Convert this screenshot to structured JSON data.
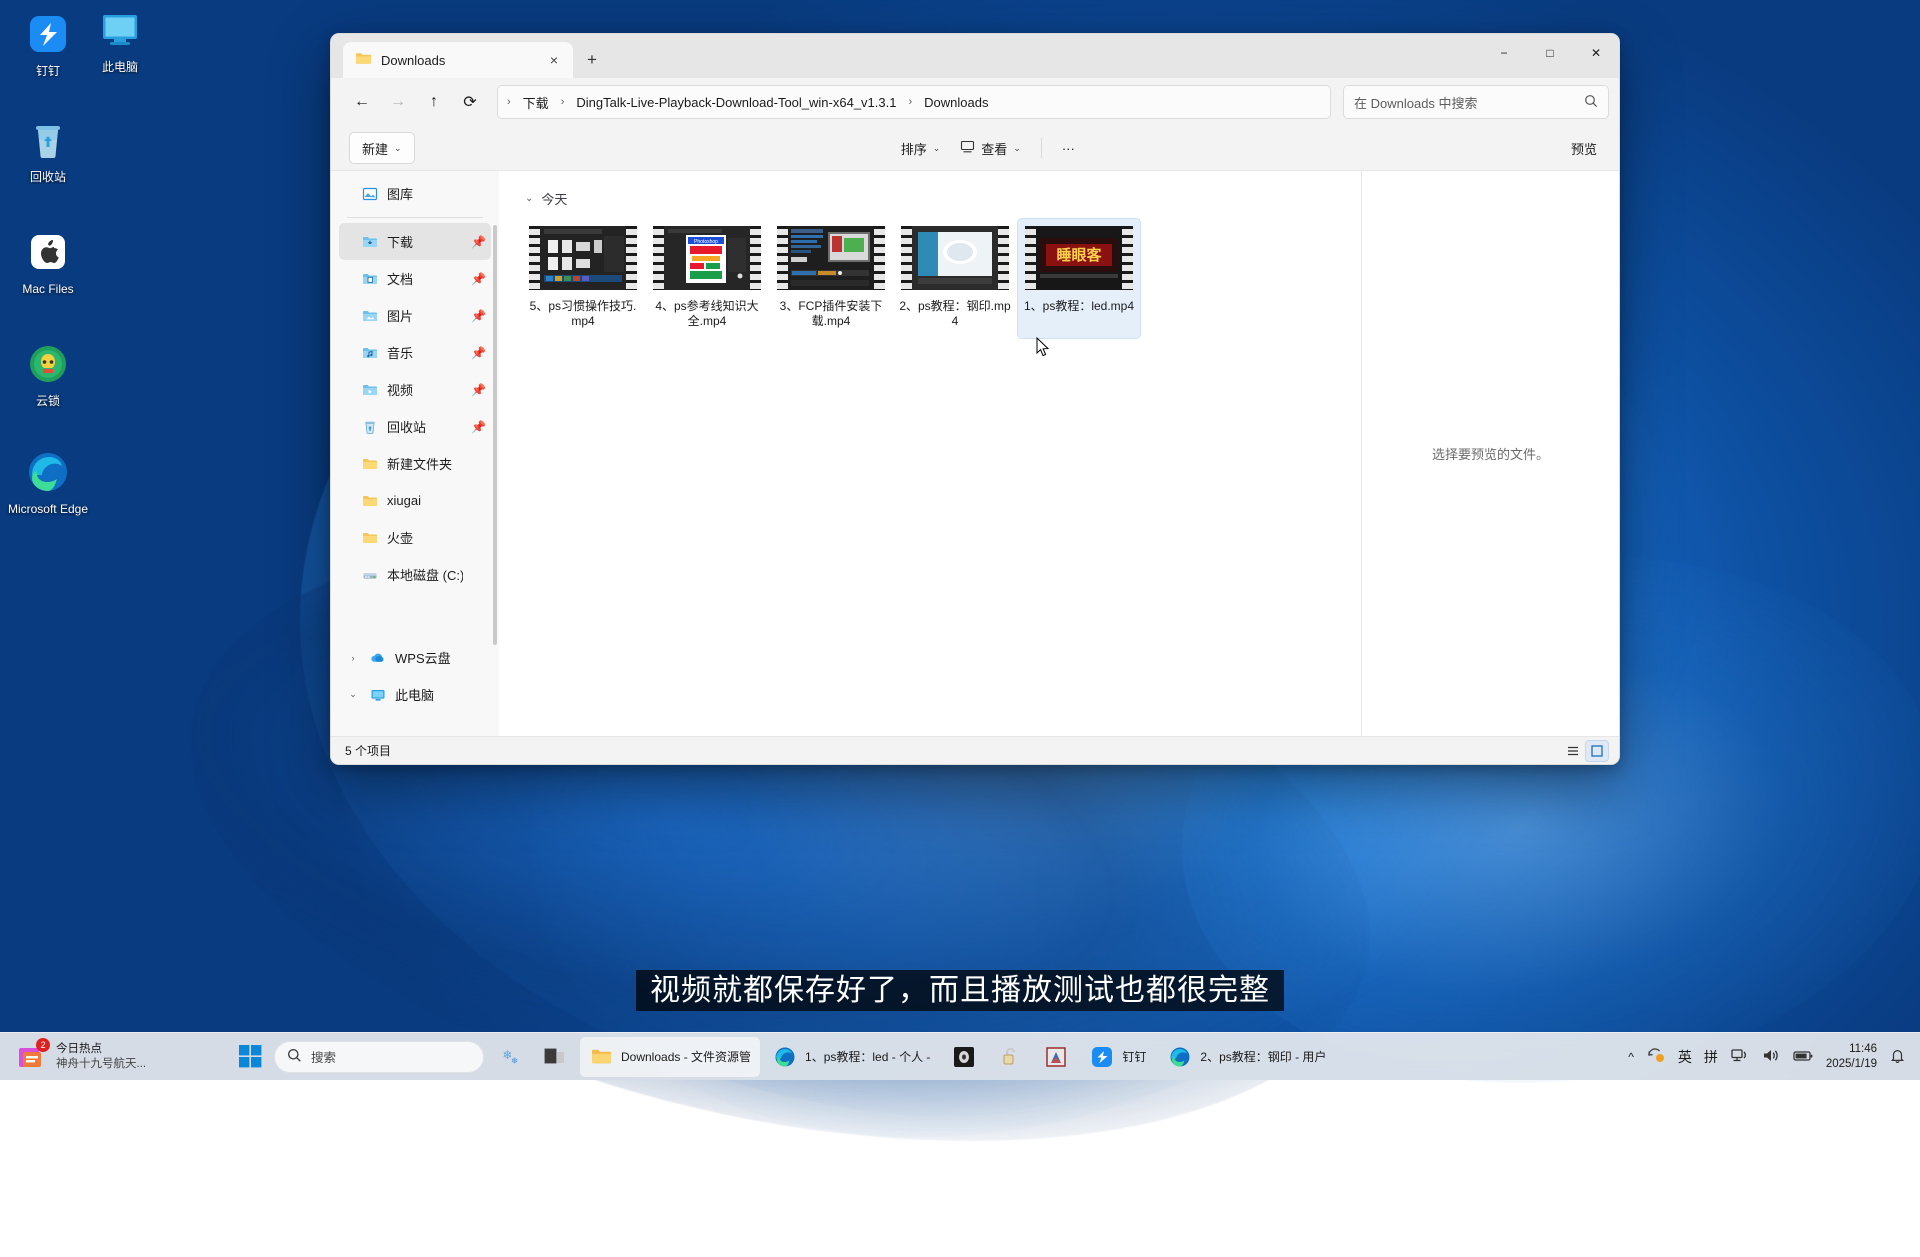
{
  "desktop": {
    "icons": [
      {
        "name": "dingtalk",
        "label": "钉钉",
        "glyph": "dingtalk-icon"
      },
      {
        "name": "this-pc",
        "label": "此电脑",
        "glyph": "monitor-icon"
      },
      {
        "name": "recycle-bin",
        "label": "回收站",
        "glyph": "recycle-bin-icon"
      },
      {
        "name": "mac-files",
        "label": "Mac Files",
        "glyph": "apple-icon"
      },
      {
        "name": "yunsuo",
        "label": "云锁",
        "glyph": "yunsuo-icon"
      },
      {
        "name": "microsoft-edge",
        "label": "Microsoft Edge",
        "glyph": "edge-icon"
      }
    ]
  },
  "explorer": {
    "tab": {
      "title": "Downloads",
      "folder_icon": "folder-icon",
      "close_icon": "×",
      "new_tab_icon": "+"
    },
    "window_controls": {
      "minimize": "−",
      "maximize": "□",
      "close": "✕"
    },
    "nav": {
      "back_icon": "←",
      "forward_icon": "→",
      "up_icon": "↑",
      "refresh_icon": "⟳"
    },
    "address": {
      "leading_sep": "›",
      "crumbs": [
        "下载",
        "DingTalk-Live-Playback-Download-Tool_win-x64_v1.3.1",
        "Downloads"
      ],
      "separator": "›"
    },
    "search": {
      "placeholder": "在 Downloads 中搜索",
      "icon": "search-icon"
    },
    "toolbar": {
      "new_label": "新建",
      "sort_label": "排序",
      "view_label": "查看",
      "more_label": "···",
      "preview_label": "预览",
      "caret": "⌄"
    },
    "sidebar": {
      "items": [
        {
          "label": "图库",
          "icon": "gallery-icon",
          "pinned": false,
          "selected": false,
          "chev": ""
        },
        {
          "label": "下载",
          "icon": "downloads-folder-icon",
          "pinned": true,
          "selected": true,
          "chev": ""
        },
        {
          "label": "文档",
          "icon": "documents-folder-icon",
          "pinned": true,
          "selected": false,
          "chev": ""
        },
        {
          "label": "图片",
          "icon": "pictures-folder-icon",
          "pinned": true,
          "selected": false,
          "chev": ""
        },
        {
          "label": "音乐",
          "icon": "music-folder-icon",
          "pinned": true,
          "selected": false,
          "chev": ""
        },
        {
          "label": "视频",
          "icon": "videos-folder-icon",
          "pinned": true,
          "selected": false,
          "chev": ""
        },
        {
          "label": "回收站",
          "icon": "recycle-bin-icon",
          "pinned": true,
          "selected": false,
          "chev": ""
        },
        {
          "label": "新建文件夹",
          "icon": "folder-icon",
          "pinned": false,
          "selected": false,
          "chev": ""
        },
        {
          "label": "xiugai",
          "icon": "folder-icon",
          "pinned": false,
          "selected": false,
          "chev": ""
        },
        {
          "label": "火壶",
          "icon": "folder-icon",
          "pinned": false,
          "selected": false,
          "chev": ""
        },
        {
          "label": "本地磁盘 (C:)",
          "icon": "drive-icon",
          "pinned": false,
          "selected": false,
          "chev": ""
        }
      ],
      "roots": [
        {
          "label": "WPS云盘",
          "icon": "wps-cloud-icon",
          "chev": "›"
        },
        {
          "label": "此电脑",
          "icon": "monitor-icon",
          "chev": "⌄"
        }
      ]
    },
    "content": {
      "group_label": "今天",
      "group_chevron": "⌄",
      "files": [
        {
          "name": "5、ps习惯操作技巧.mp4",
          "thumb": "ps-workspace-thumb",
          "selected": false
        },
        {
          "name": "4、ps参考线知识大全.mp4",
          "thumb": "ps-poster-thumb",
          "selected": false
        },
        {
          "name": "3、FCP插件安装下载.mp4",
          "thumb": "fcp-editor-thumb",
          "selected": false
        },
        {
          "name": "2、ps教程：钢印.mp4",
          "thumb": "ps-stamp-thumb",
          "selected": false
        },
        {
          "name": "1、ps教程：led.mp4",
          "thumb": "led-sign-thumb",
          "selected": true
        }
      ]
    },
    "preview": {
      "empty_text": "选择要预览的文件。"
    },
    "status": {
      "item_count": "5 个项目",
      "list_view_icon": "list-view-icon",
      "grid_view_icon": "grid-view-icon"
    }
  },
  "subtitle": {
    "text": "视频就都保存好了，而且播放测试也都很完整"
  },
  "taskbar": {
    "news": {
      "badge_count": "2",
      "title": "今日热点",
      "subtitle": "神舟十九号航天...",
      "icon": "news-icon"
    },
    "start_icon": "windows-start-icon",
    "search": {
      "placeholder": "搜索",
      "icon": "search-icon"
    },
    "weather_icon": "snow-weather-icon",
    "apps": [
      {
        "label": "",
        "icon": "task-view-icon",
        "name": "task-view-button",
        "active": false
      },
      {
        "label": "Downloads - 文件资源管",
        "icon": "folder-icon",
        "name": "taskbar-file-explorer",
        "active": true
      },
      {
        "label": "1、ps教程：led - 个人 -",
        "icon": "edge-icon",
        "name": "taskbar-edge-led",
        "active": false
      },
      {
        "label": "",
        "icon": "media-player-icon",
        "name": "taskbar-media-player",
        "active": false
      },
      {
        "label": "",
        "icon": "unlock-icon",
        "name": "taskbar-unlock",
        "active": false
      },
      {
        "label": "",
        "icon": "winrar-icon",
        "name": "taskbar-winrar",
        "active": false
      },
      {
        "label": "钉钉",
        "icon": "dingtalk-icon",
        "name": "taskbar-dingtalk",
        "active": false
      },
      {
        "label": "2、ps教程：钢印 - 用户",
        "icon": "edge-icon",
        "name": "taskbar-edge-stamp",
        "active": false
      }
    ],
    "tray": {
      "overflow_icon": "^",
      "sync_icon": "onedrive-sync-icon",
      "ime_lang": "英",
      "ime_mode": "拼",
      "network_icon": "network-icon",
      "volume_icon": "volume-icon",
      "battery_icon": "battery-icon",
      "time": "11:46",
      "date": "2025/1/19",
      "notification_icon": "bell-icon"
    }
  },
  "colors": {
    "accent": "#0078d4",
    "window_bg": "#f3f3f3",
    "selection": "#e4eff9",
    "taskbar_bg": "#f3f3f3"
  }
}
